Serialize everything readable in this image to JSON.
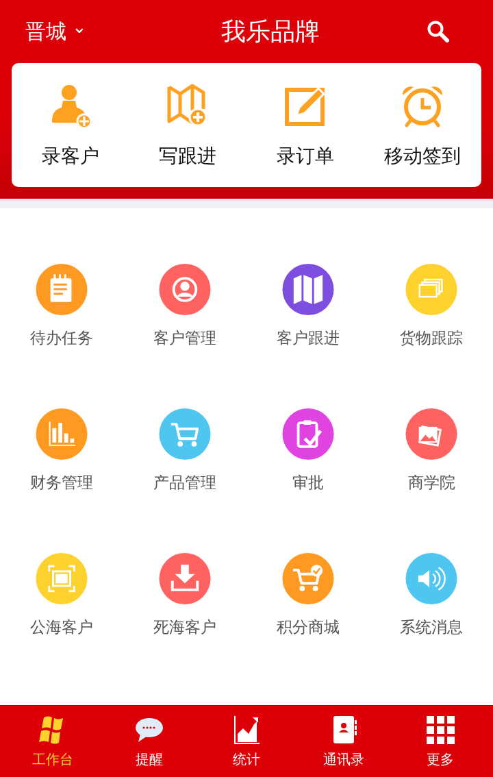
{
  "header": {
    "city": "晋城",
    "city_caret": "⌄",
    "title": "我乐品牌"
  },
  "quick_actions": [
    {
      "label": "录客户",
      "kind": "user-add"
    },
    {
      "label": "写跟进",
      "kind": "map-add"
    },
    {
      "label": "录订单",
      "kind": "edit"
    },
    {
      "label": "移动签到",
      "kind": "alarm"
    }
  ],
  "modules": [
    {
      "label": "待办任务",
      "kind": "notepad",
      "color": "#fe9a22"
    },
    {
      "label": "客户管理",
      "kind": "person",
      "color": "#fe6261"
    },
    {
      "label": "客户跟进",
      "kind": "map",
      "color": "#7e4ee0"
    },
    {
      "label": "货物跟踪",
      "kind": "cards",
      "color": "#fed22e"
    },
    {
      "label": "财务管理",
      "kind": "bars",
      "color": "#fe9a22"
    },
    {
      "label": "产品管理",
      "kind": "cart",
      "color": "#4fc6ef"
    },
    {
      "label": "审批",
      "kind": "clipboard",
      "color": "#e043e0"
    },
    {
      "label": "商学院",
      "kind": "photos",
      "color": "#fe6261"
    },
    {
      "label": "公海客户",
      "kind": "frame",
      "color": "#fed22e"
    },
    {
      "label": "死海客户",
      "kind": "download",
      "color": "#fe6261"
    },
    {
      "label": "积分商城",
      "kind": "cart-check",
      "color": "#fe9a22"
    },
    {
      "label": "系统消息",
      "kind": "speaker",
      "color": "#4fc6ef"
    }
  ],
  "tabs": [
    {
      "label": "工作台",
      "kind": "windows",
      "selected": true
    },
    {
      "label": "提醒",
      "kind": "chat",
      "selected": false
    },
    {
      "label": "统计",
      "kind": "chart",
      "selected": false
    },
    {
      "label": "通讯录",
      "kind": "contacts",
      "selected": false
    },
    {
      "label": "更多",
      "kind": "grid",
      "selected": false
    }
  ]
}
